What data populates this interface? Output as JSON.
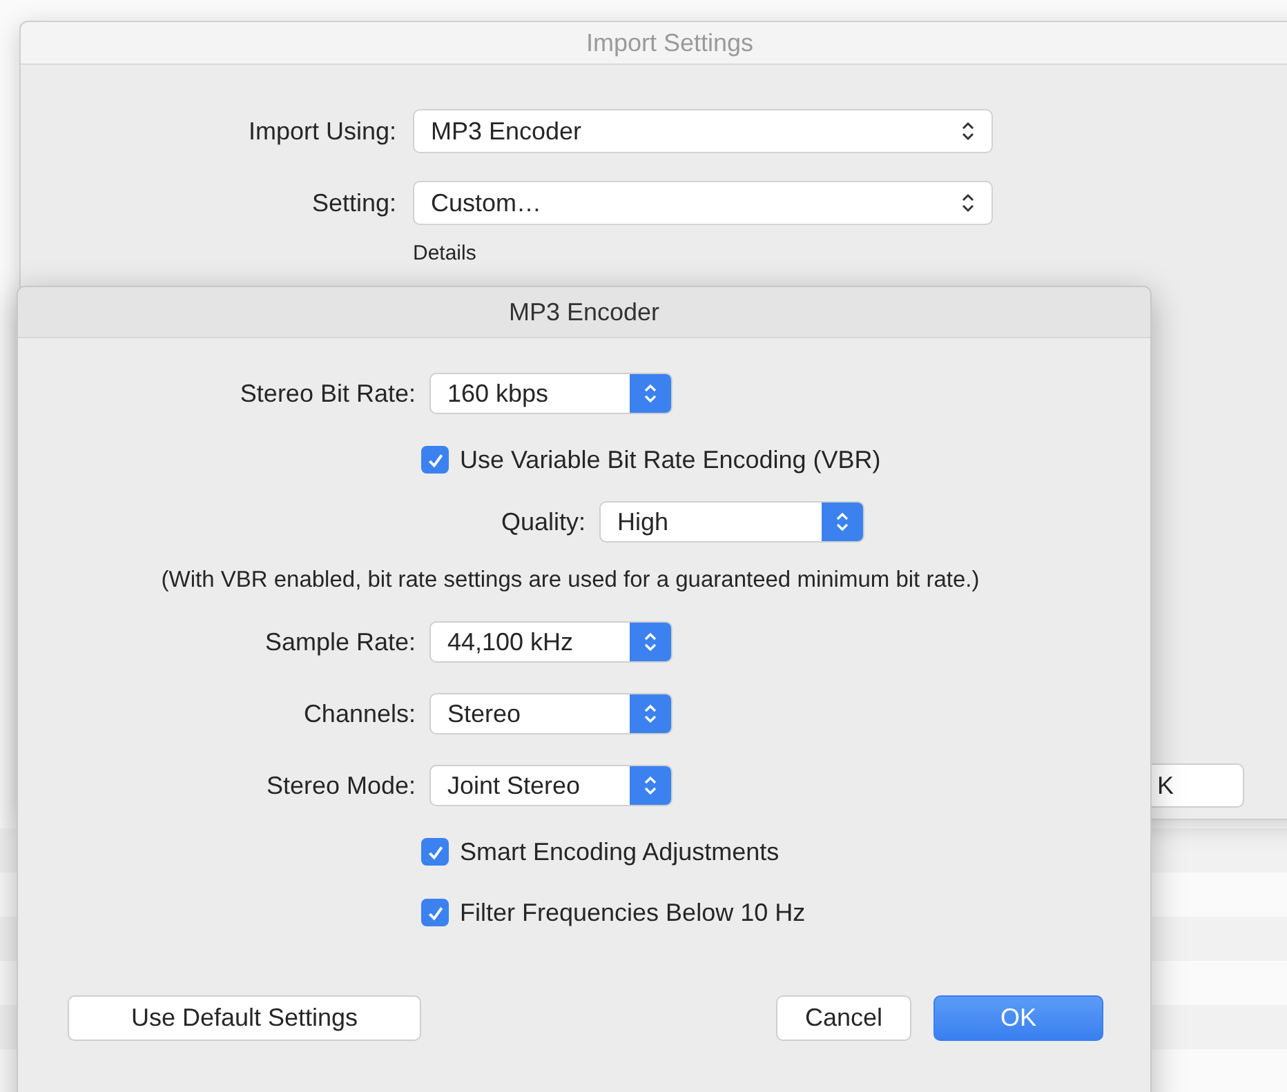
{
  "background_window": {
    "title": "Import Settings",
    "fields": [
      {
        "label": "Import Using:",
        "value": "MP3 Encoder"
      },
      {
        "label": "Setting:",
        "value": "Custom…"
      }
    ],
    "details_label": "Details",
    "partial_button": "K"
  },
  "dialog": {
    "title": "MP3 Encoder",
    "rows": [
      {
        "kind": "select",
        "label": "Stereo Bit Rate:",
        "value": "160 kbps"
      },
      {
        "kind": "checkbox",
        "label": "Use Variable Bit Rate Encoding (VBR)",
        "checked": true
      },
      {
        "kind": "subselect",
        "label": "Quality:",
        "value": "High"
      },
      {
        "kind": "note",
        "text": "(With VBR enabled, bit rate settings are used for a guaranteed minimum bit rate.)"
      },
      {
        "kind": "select",
        "label": "Sample Rate:",
        "value": "44,100 kHz"
      },
      {
        "kind": "select",
        "label": "Channels:",
        "value": "Stereo"
      },
      {
        "kind": "select",
        "label": "Stereo Mode:",
        "value": "Joint Stereo"
      },
      {
        "kind": "checkbox",
        "label": "Smart Encoding Adjustments",
        "checked": true
      },
      {
        "kind": "checkbox",
        "label": "Filter Frequencies Below 10 Hz",
        "checked": true
      }
    ],
    "buttons": [
      {
        "label": "Use Default Settings",
        "default": false
      },
      {
        "label": "Cancel",
        "default": false
      },
      {
        "label": "OK",
        "default": true
      }
    ]
  }
}
